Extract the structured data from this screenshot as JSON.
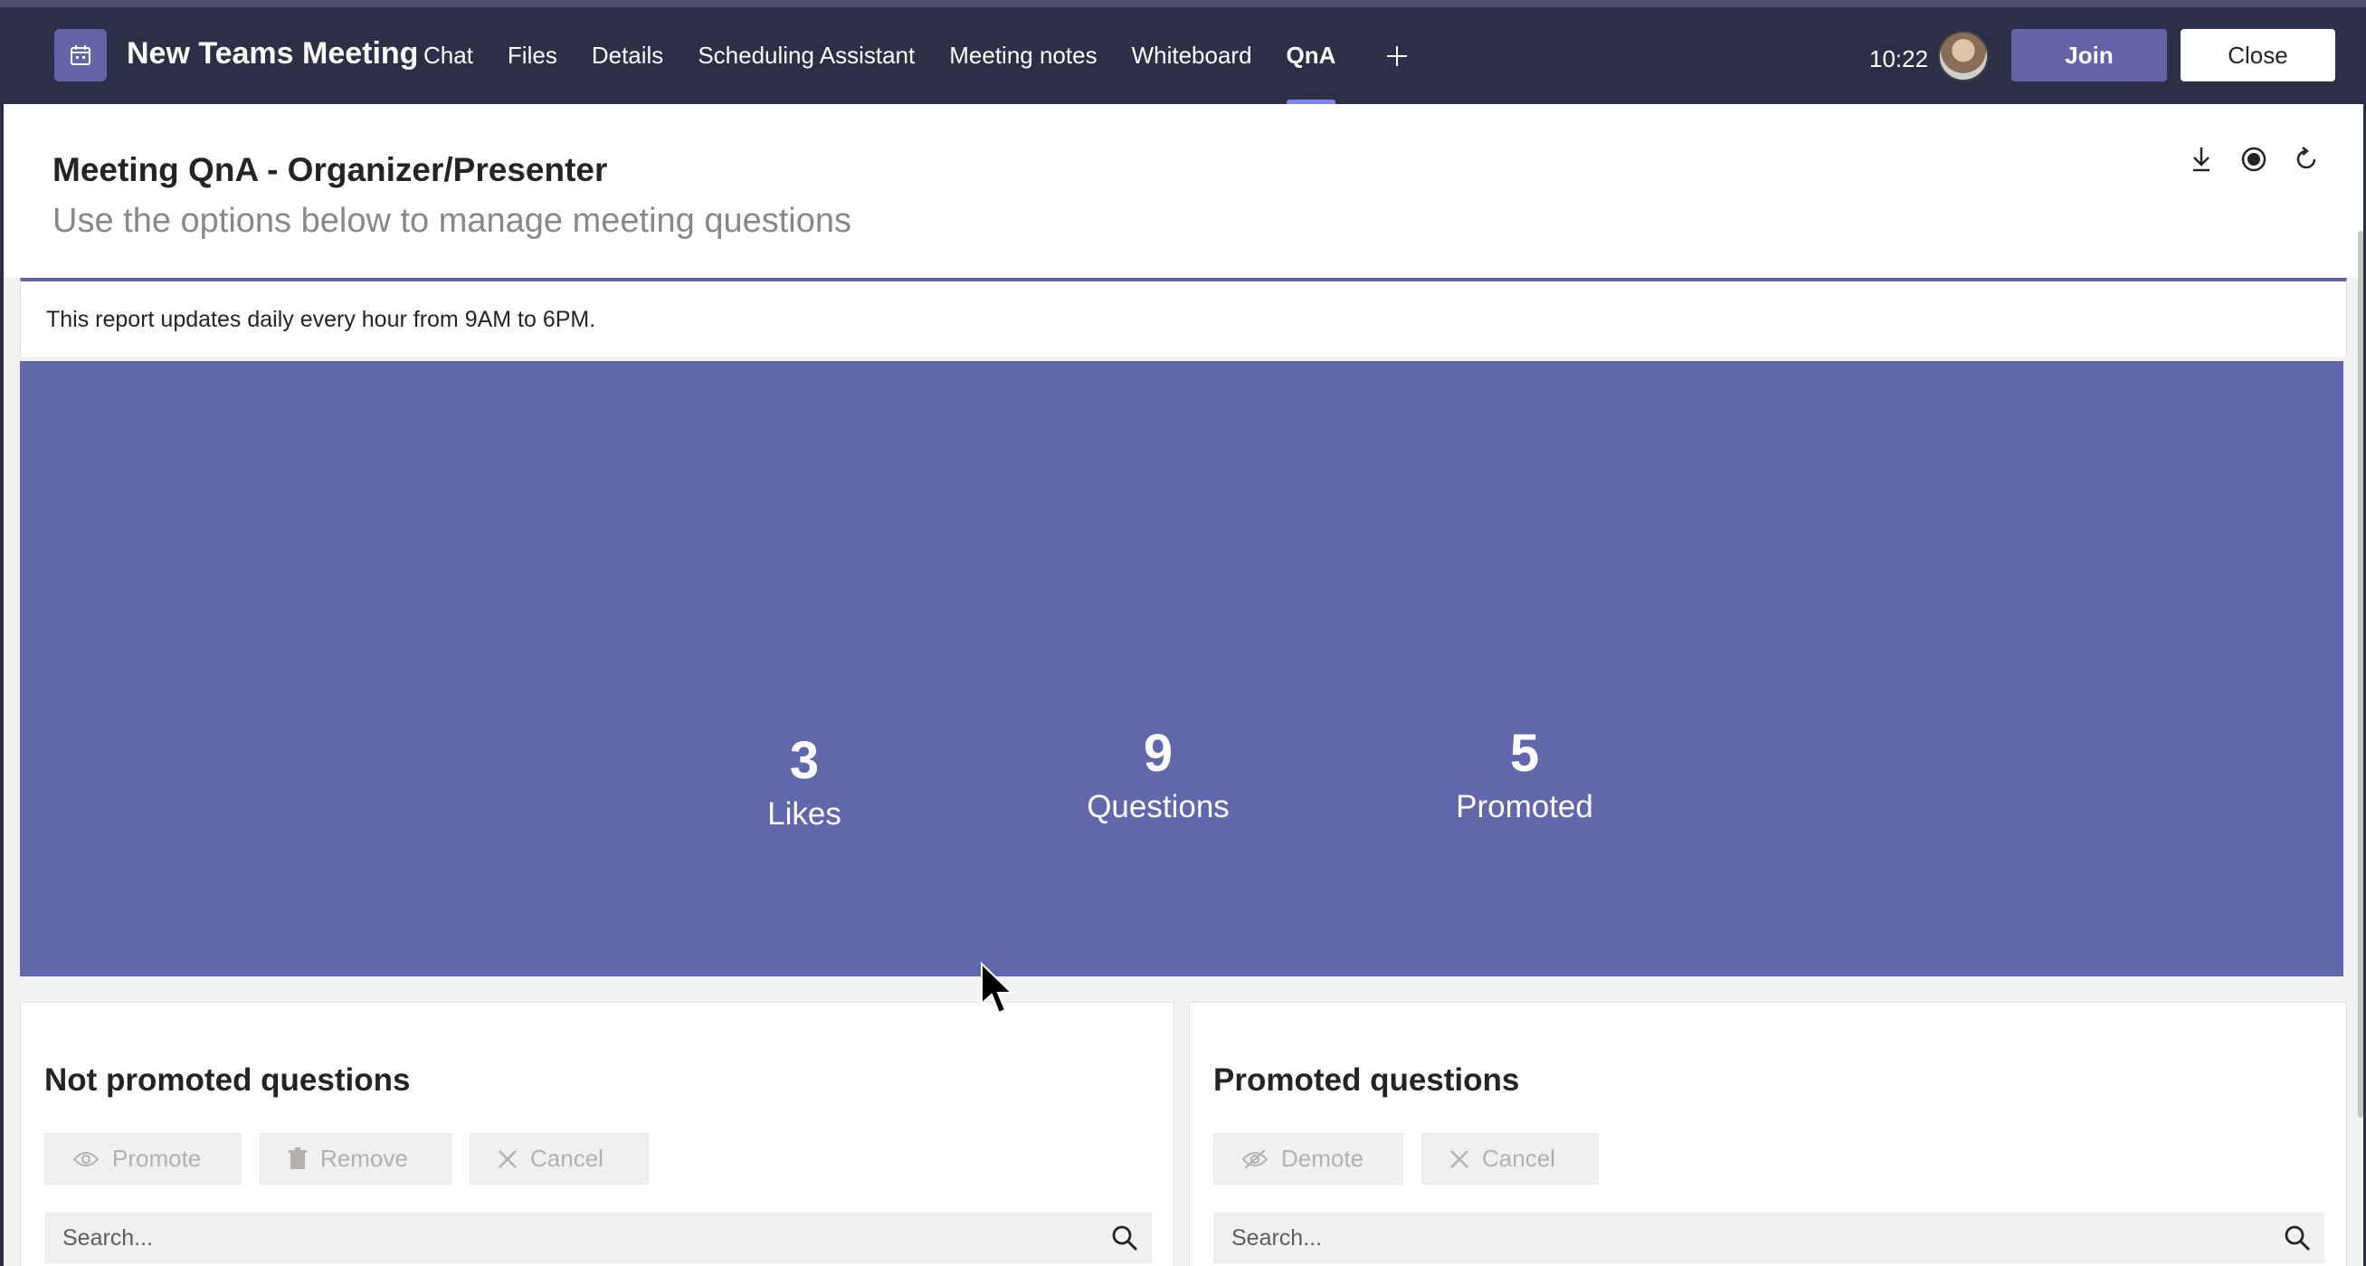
{
  "header": {
    "meeting_title": "New Teams Meeting",
    "tabs": [
      {
        "label": "Chat"
      },
      {
        "label": "Files"
      },
      {
        "label": "Details"
      },
      {
        "label": "Scheduling Assistant"
      },
      {
        "label": "Meeting notes"
      },
      {
        "label": "Whiteboard"
      },
      {
        "label": "QnA",
        "active": true
      }
    ],
    "clock": "10:22",
    "join_label": "Join",
    "close_label": "Close"
  },
  "page": {
    "title": "Meeting QnA - Organizer/Presenter",
    "subtitle": "Use the options below to manage meeting questions"
  },
  "notice": "This report updates daily every hour from 9AM to 6PM.",
  "stats": [
    {
      "value": "3",
      "label": "Likes"
    },
    {
      "value": "9",
      "label": "Questions"
    },
    {
      "value": "5",
      "label": "Promoted"
    }
  ],
  "not_promoted": {
    "title": "Not promoted questions",
    "promote_label": "Promote",
    "remove_label": "Remove",
    "cancel_label": "Cancel",
    "search_placeholder": "Search..."
  },
  "promoted": {
    "title": "Promoted questions",
    "demote_label": "Demote",
    "cancel_label": "Cancel",
    "search_placeholder": "Search..."
  },
  "colors": {
    "header_bg": "#2d2f47",
    "accent": "#6264a7",
    "stats_bg": "#6167ab"
  }
}
